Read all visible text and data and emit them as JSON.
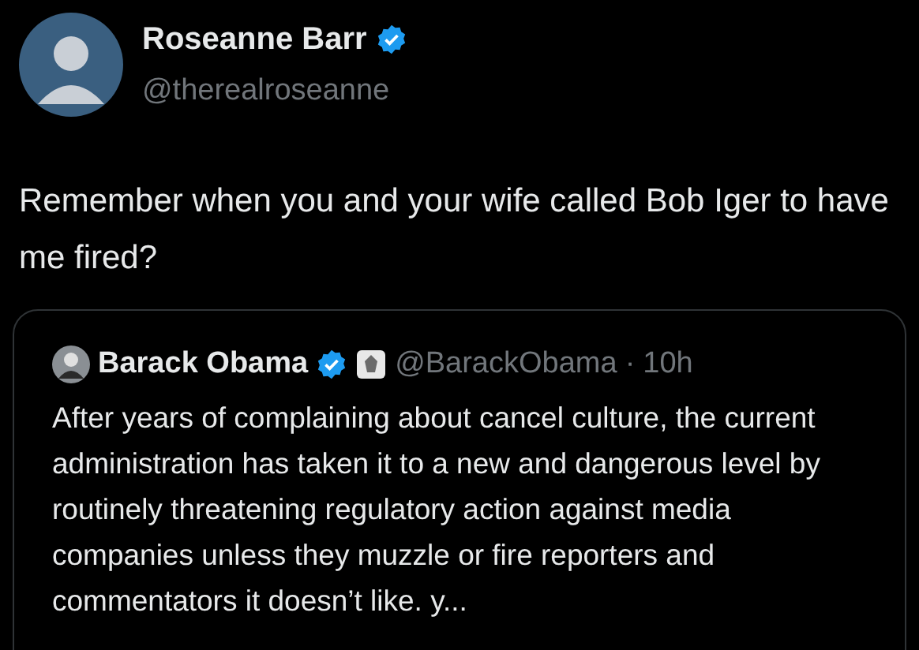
{
  "author": {
    "name": "Roseanne Barr",
    "verified": true,
    "handle": "@therealroseanne"
  },
  "text": "Remember when you and your wife called Bob Iger to have me fired?",
  "quoted": {
    "name": "Barack Obama",
    "verified": true,
    "government_badge": true,
    "handle": "@BarackObama",
    "separator": "·",
    "time": "10h",
    "text": "After years of complaining about cancel culture, the current administration has taken it to a new and dangerous level by routinely threatening regulatory action against media companies unless they muzzle or fire reporters and commentators it doesn’t like. y..."
  }
}
